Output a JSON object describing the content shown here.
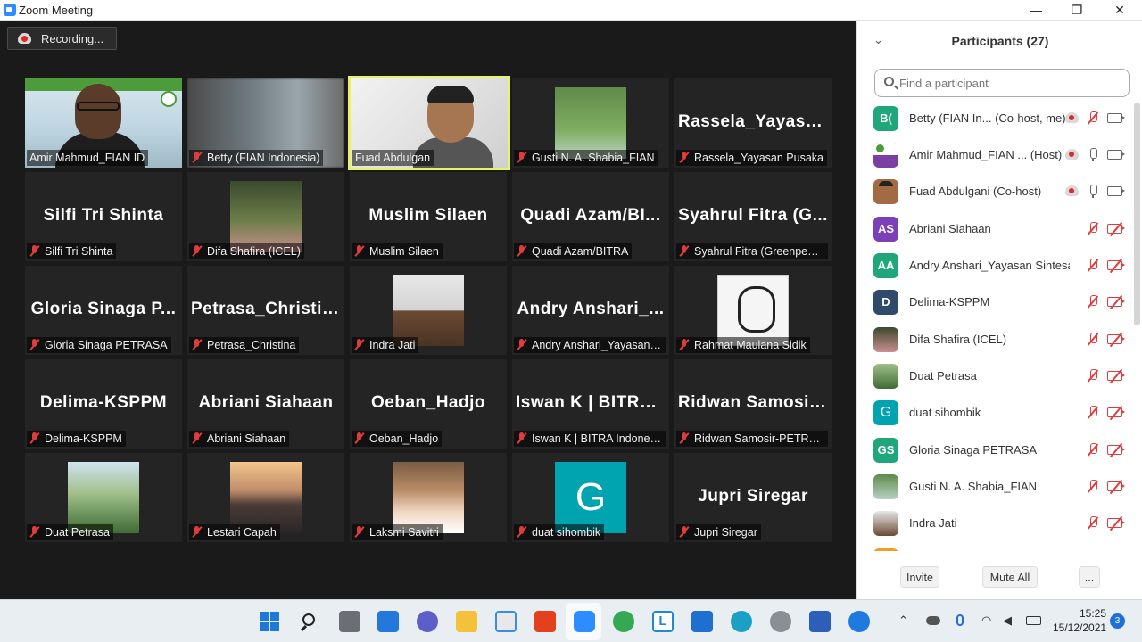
{
  "window": {
    "title": "Zoom Meeting",
    "min": "—",
    "max": "❐",
    "close": "✕"
  },
  "recording": {
    "label": "Recording..."
  },
  "tiles": [
    {
      "name": "Amir Mahmud_FIAN ID",
      "muted": false
    },
    {
      "name": "Betty (FIAN Indonesia)",
      "muted": true
    },
    {
      "name": "Fuad Abdulgan",
      "muted": false
    },
    {
      "name": "Gusti N. A. Shabia_FIAN",
      "muted": true
    },
    {
      "big": "Rassela_Yayasa...",
      "name": "Rassela_Yayasan Pusaka",
      "muted": true
    },
    {
      "big": "Silfi Tri Shinta",
      "name": "Silfi Tri Shinta",
      "muted": true
    },
    {
      "name": "Difa Shafira (ICEL)",
      "muted": true
    },
    {
      "big": "Muslim Silaen",
      "name": "Muslim Silaen",
      "muted": true
    },
    {
      "big": "Quadi Azam/BI...",
      "name": "Quadi Azam/BITRA",
      "muted": true
    },
    {
      "big": "Syahrul Fitra (G...",
      "name": "Syahrul Fitra (Greenpeace)",
      "muted": true
    },
    {
      "big": "Gloria Sinaga P...",
      "name": "Gloria Sinaga PETRASA",
      "muted": true
    },
    {
      "big": "Petrasa_Christina",
      "name": "Petrasa_Christina",
      "muted": true
    },
    {
      "name": "Indra Jati",
      "muted": true
    },
    {
      "big": "Andry Anshari_...",
      "name": "Andry Anshari_Yayasan Si...",
      "muted": true
    },
    {
      "name": "Rahmat Maulana Sidik",
      "muted": true
    },
    {
      "big": "Delima-KSPPM",
      "name": "Delima-KSPPM",
      "muted": true
    },
    {
      "big": "Abriani Siahaan",
      "name": "Abriani Siahaan",
      "muted": true
    },
    {
      "big": "Oeban_Hadjo",
      "name": "Oeban_Hadjo",
      "muted": true
    },
    {
      "big": "Iswan K | BITRA...",
      "name": "Iswan K | BITRA Indonesia",
      "muted": true
    },
    {
      "big": "Ridwan Samosir...",
      "name": "Ridwan Samosir-PETRASA",
      "muted": true
    },
    {
      "name": "Duat Petrasa",
      "muted": true
    },
    {
      "name": "Lestari Capah",
      "muted": true
    },
    {
      "name": "Laksmi Savitri",
      "muted": true
    },
    {
      "avatar_letter": "G",
      "name": "duat sihombik",
      "muted": true
    },
    {
      "big": "Jupri Siregar",
      "name": "Jupri Siregar",
      "muted": true
    }
  ],
  "participants": {
    "title": "Participants (27)",
    "search_placeholder": "Find a participant",
    "list": [
      {
        "initials": "B(",
        "color": "#1fa67a",
        "name": "Betty (FIAN In...",
        "role": "(Co-host, me)",
        "rec": true,
        "mic_muted": true,
        "cam_muted": false
      },
      {
        "initials": "",
        "color": "#7a3fa0",
        "name": "Amir Mahmud_FIAN ...",
        "role": "(Host)",
        "rec": true,
        "mic_muted": false,
        "cam_muted": false
      },
      {
        "initials": "",
        "color": "#a46a44",
        "name": "Fuad Abdulgani",
        "role": "(Co-host)",
        "rec": true,
        "mic_muted": false,
        "cam_muted": false
      },
      {
        "initials": "AS",
        "color": "#7b3fb8",
        "name": "Abriani Siahaan",
        "role": "",
        "rec": false,
        "mic_muted": true,
        "cam_muted": true
      },
      {
        "initials": "AA",
        "color": "#1fa67a",
        "name": "Andry Anshari_Yayasan Sintesa",
        "role": "",
        "rec": false,
        "mic_muted": true,
        "cam_muted": true
      },
      {
        "initials": "D",
        "color": "#2f4a6b",
        "name": "Delima-KSPPM",
        "role": "",
        "rec": false,
        "mic_muted": true,
        "cam_muted": true
      },
      {
        "initials": "",
        "color": "#8a6d3b",
        "name": "Difa Shafira (ICEL)",
        "role": "",
        "rec": false,
        "mic_muted": true,
        "cam_muted": true
      },
      {
        "initials": "",
        "color": "#4f7a3a",
        "name": "Duat Petrasa",
        "role": "",
        "rec": false,
        "mic_muted": true,
        "cam_muted": true
      },
      {
        "initials": "G",
        "color": "#00a3b0",
        "name": "duat sihombik",
        "role": "",
        "rec": false,
        "mic_muted": true,
        "cam_muted": true
      },
      {
        "initials": "GS",
        "color": "#1fa67a",
        "name": "Gloria Sinaga PETRASA",
        "role": "",
        "rec": false,
        "mic_muted": true,
        "cam_muted": true
      },
      {
        "initials": "",
        "color": "#5f8a4a",
        "name": "Gusti N. A. Shabia_FIAN",
        "role": "",
        "rec": false,
        "mic_muted": true,
        "cam_muted": true
      },
      {
        "initials": "",
        "color": "#6b4a33",
        "name": "Indra Jati",
        "role": "",
        "rec": false,
        "mic_muted": true,
        "cam_muted": true
      }
    ],
    "buttons": {
      "invite": "Invite",
      "mute_all": "Mute All",
      "more": "..."
    }
  },
  "taskbar": {
    "time": "15:25",
    "date": "15/12/2021",
    "notifications": "3"
  }
}
